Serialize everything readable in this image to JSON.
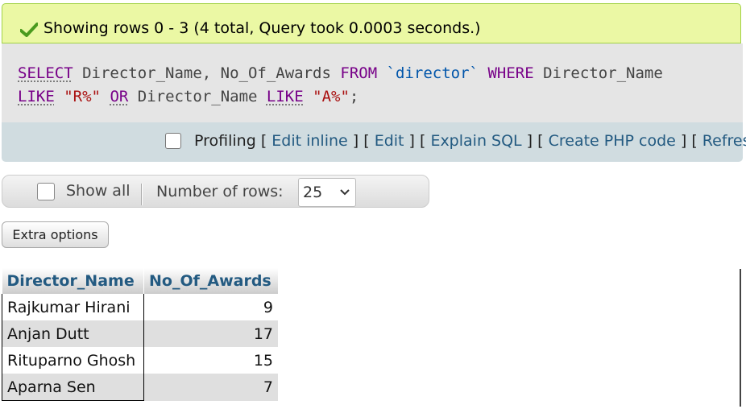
{
  "status": {
    "message": "Showing rows 0 - 3 (4 total, Query took 0.0003 seconds.)"
  },
  "sql": {
    "line1": {
      "t1": "SELECT",
      "t2": " Director_Name, No_Of_Awards ",
      "t3": "FROM",
      "t4": " ",
      "t5": "`director`",
      "t6": " ",
      "t7": "WHERE",
      "t8": " Director_Name"
    },
    "line2": {
      "t1": "LIKE",
      "t2": " ",
      "t3": "\"R%\"",
      "t4": " ",
      "t5": "OR",
      "t6": " Director_Name ",
      "t7": "LIKE",
      "t8": " ",
      "t9": "\"A%\"",
      "t10": ";"
    }
  },
  "tools": {
    "profiling": "Profiling",
    "links": [
      "Edit inline",
      "Edit",
      "Explain SQL",
      "Create PHP code",
      "Refresh"
    ]
  },
  "navigation": {
    "show_all": "Show all",
    "rows_label": "Number of rows:",
    "rows_value": "25"
  },
  "extra_options": "Extra options",
  "table": {
    "headers": [
      "Director_Name",
      "No_Of_Awards"
    ],
    "rows": [
      {
        "name": "Rajkumar Hirani",
        "awards": "9"
      },
      {
        "name": "Anjan Dutt",
        "awards": "17"
      },
      {
        "name": "Rituparno Ghosh",
        "awards": "15"
      },
      {
        "name": "Aparna Sen",
        "awards": "7"
      }
    ]
  },
  "colors": {
    "success_bg": "#ebf8a4",
    "link": "#235a81",
    "keyword": "#770088",
    "string": "#aa1111"
  }
}
